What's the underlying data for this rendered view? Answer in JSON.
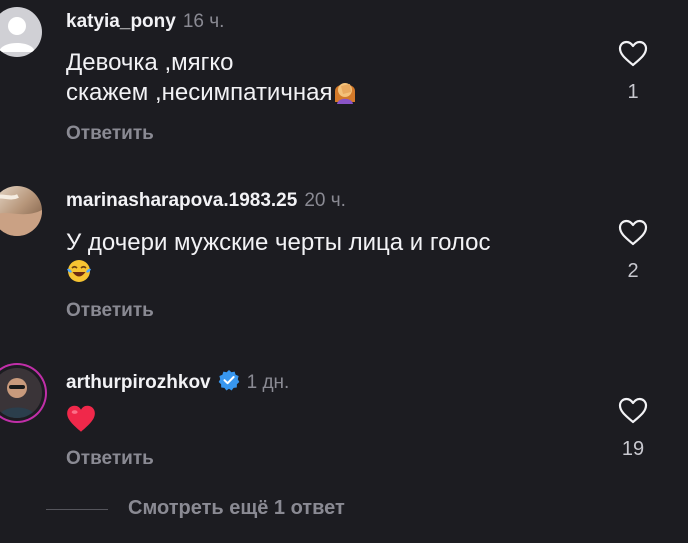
{
  "comments": [
    {
      "username": "katyia_pony",
      "time": "16 ч.",
      "text_lines": [
        "Девочка ,мягко",
        "скажем ,несимпатичная"
      ],
      "emoji": "woman-facepalming-icon",
      "reply_label": "Ответить",
      "likes": "1",
      "verified": false
    },
    {
      "username": "marinasharapova.1983.25",
      "time": "20 ч.",
      "text_lines": [
        "У дочери мужские черты лица и голос"
      ],
      "emoji": "face-with-tears-of-joy-icon",
      "reply_label": "Ответить",
      "likes": "2",
      "verified": false
    },
    {
      "username": "arthurpirozhkov",
      "time": "1 дн.",
      "text_lines": [],
      "emoji": "red-heart-icon",
      "reply_label": "Ответить",
      "likes": "19",
      "verified": true
    }
  ],
  "view_more": {
    "label": "Смотреть ещё 1 ответ"
  },
  "colors": {
    "background": "#1c1c21",
    "text": "#f2f2f5",
    "muted": "#8a8a93",
    "verified": "#3897f0",
    "story_ring": "#c02fa8"
  }
}
